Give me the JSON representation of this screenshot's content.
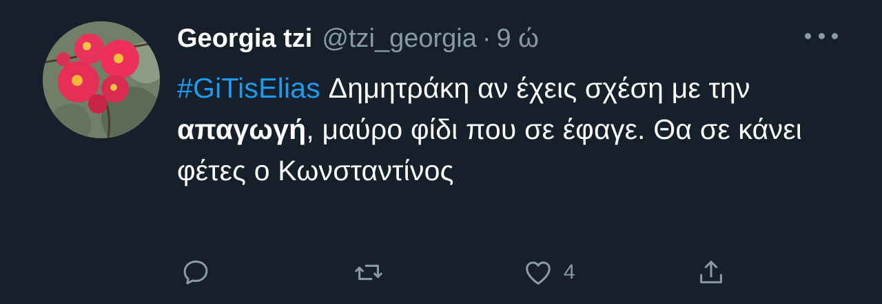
{
  "tweet": {
    "display_name": "Georgia tzi",
    "handle": "@tzi_georgia",
    "separator": "·",
    "time": "9 ώ",
    "avatar_icon": "flower-avatar",
    "more_icon": "more-dots-icon",
    "body": {
      "hashtag": "#GiTisElias",
      "text_1": " Δημητράκη αν έχεις σχέση με την ",
      "bold_text": "απαγωγή",
      "text_2": ", μαύρο φίδι που σε έφαγε. Θα σε κάνει φέτες ο Κωνσταντίνος"
    },
    "actions": {
      "reply_icon": "reply-icon",
      "retweet_icon": "retweet-icon",
      "like_icon": "heart-icon",
      "like_count": "4",
      "share_icon": "share-icon"
    }
  },
  "colors": {
    "background": "#15202b",
    "text": "#ffffff",
    "secondary": "#8b98a5",
    "accent": "#1d9bf0"
  }
}
